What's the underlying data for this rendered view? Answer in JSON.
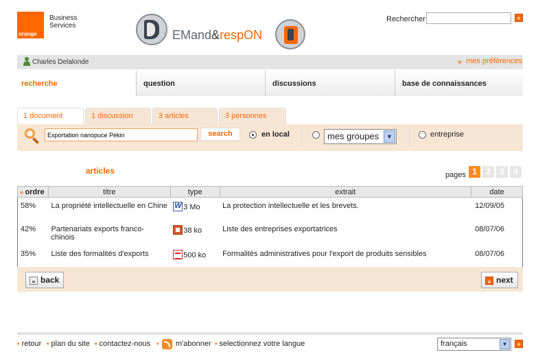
{
  "brand": {
    "logo_small": "orange",
    "logo_line1": "Business",
    "logo_line2": "Services",
    "color": "#ff6600"
  },
  "app": {
    "title_part1": "EMand",
    "title_amp": "&",
    "title_part2": "respON"
  },
  "top_search": {
    "label": "Rechercher",
    "value": "",
    "go_icon": "go-arrow-icon"
  },
  "userbar": {
    "user_name": "Charles Delalonde",
    "prefs_label": "mes préférences"
  },
  "main_nav": [
    {
      "label": "recherche",
      "active": true
    },
    {
      "label": "question"
    },
    {
      "label": "discussions"
    },
    {
      "label": "base de connaissances"
    }
  ],
  "result_tabs": [
    {
      "label": "1 document",
      "active": true
    },
    {
      "label": "1 discussion"
    },
    {
      "label": "3 articles"
    },
    {
      "label": "3 personnes"
    }
  ],
  "search": {
    "query": "Exportation nanopuce Pékin",
    "button": "search",
    "scope_local": "en local",
    "scope_groups_value": "mes groupes",
    "scope_enterprise": "entreprise",
    "selected_scope": "en local"
  },
  "results": {
    "section_title": "articles",
    "pages_label": "pages",
    "pages": [
      "1",
      "2",
      "3",
      "4"
    ],
    "current_page": "1",
    "columns": [
      "ordre",
      "titre",
      "type",
      "extrait",
      "date"
    ],
    "rows": [
      {
        "ordre": "58%",
        "titre": "La propriété intellectuelle en Chine",
        "type_icon": "word-doc-icon",
        "size": "3 Mo",
        "extrait": "La protection intellectuelle et les brevets.",
        "date": "12/09/05"
      },
      {
        "ordre": "42%",
        "titre": "Partenariats exports franco-chinois",
        "type_icon": "ppt-doc-icon",
        "size": "38 ko",
        "extrait": "Liste des entreprises exportatrices",
        "date": "08/07/06"
      },
      {
        "ordre": "35%",
        "titre": "Liste des formalités d'exports",
        "type_icon": "pdf-doc-icon",
        "size": "500 ko",
        "extrait": "Formalités administratives pour l'export de produits sensibles",
        "date": "08/07/06"
      }
    ]
  },
  "actions": {
    "back": "back",
    "next": "next"
  },
  "footer": {
    "links": [
      "retour",
      "plan du site",
      "contactez-nous"
    ],
    "subscribe": "m'abonner",
    "language_prompt": "selectionnez votre langue",
    "language_value": "français"
  }
}
